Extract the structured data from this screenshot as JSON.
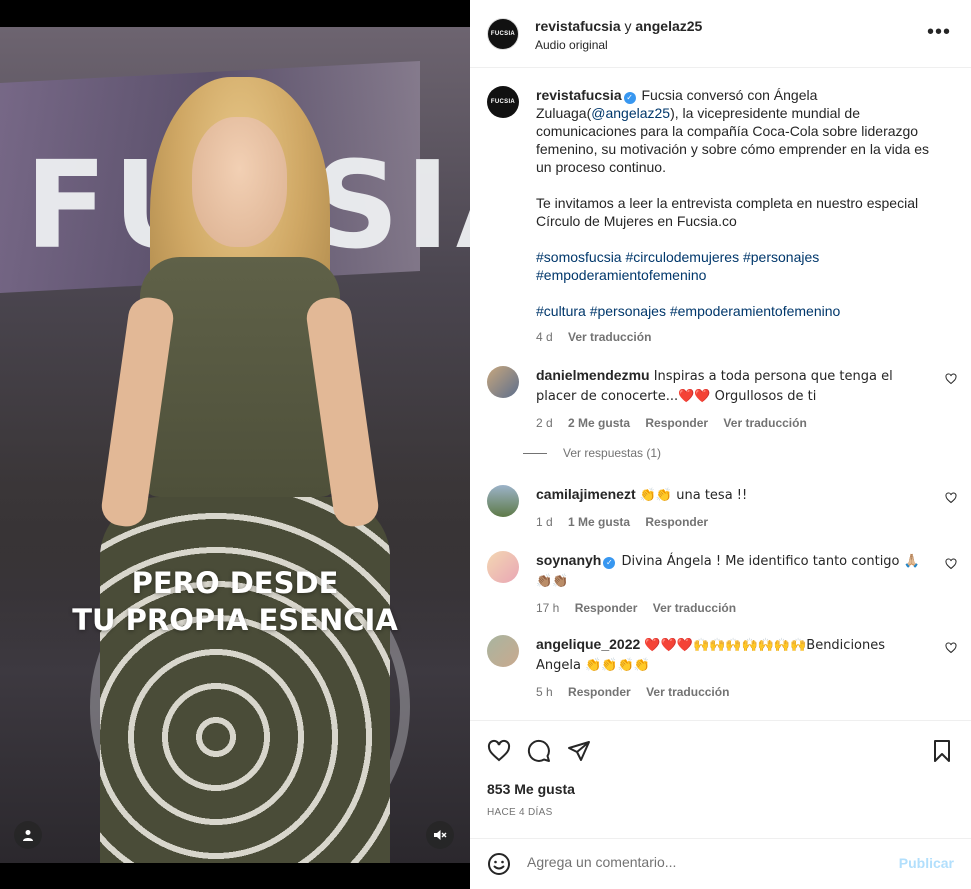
{
  "video": {
    "wall_brand": "FUCSIA",
    "overlay_line1": "PERO DESDE",
    "overlay_line2": "TU PROPIA ESENCIA"
  },
  "header": {
    "avatar_text": "FUCSIA",
    "user1": "revistafucsia",
    "joiner": " y ",
    "user2": "angelaz25",
    "subtitle": "Audio original",
    "more": "•••"
  },
  "caption": {
    "username": "revistafucsia",
    "verified_mark": "✓",
    "text1_a": " Fucsia conversó con Ángela Zuluaga(",
    "mention": "@angelaz25",
    "text1_b": "), la vicepresidente mundial de comunicaciones para la compañía Coca-Cola sobre liderazgo femenino, su motivación y sobre cómo emprender en la vida es un proceso continuo.",
    "text2": "Te invitamos a leer la entrevista completa en nuestro especial Círculo de Mujeres en Fucsia.co",
    "tags1": "#somosfucsia #circulodemujeres #personajes #empoderamientofemenino",
    "tags2": "#cultura #personajes #empoderamientofemenino",
    "time": "4 d",
    "translate": "Ver traducción"
  },
  "comments": [
    {
      "username": "danielmendezmu",
      "text": " Inspiras a toda persona que tenga el placer de conocerte...❤️❤️ Orgullosos de ti",
      "time": "2 d",
      "likes": "2 Me gusta",
      "reply": "Responder",
      "translate": "Ver traducción",
      "view_replies": "Ver respuestas (1)"
    },
    {
      "username": "camilajimenezt",
      "text": " 👏👏 una tesa !!",
      "time": "1 d",
      "likes": "1 Me gusta",
      "reply": "Responder"
    },
    {
      "username": "soynanyh",
      "verified_mark": "✓",
      "text": " Divina Ángela ! Me identifico tanto contigo 🙏🏼👏🏽👏🏽",
      "time": "17 h",
      "reply": "Responder",
      "translate": "Ver traducción"
    },
    {
      "username": "angelique_2022",
      "text": " ❤️❤️❤️🙌🙌🙌🙌🙌🙌🙌Bendiciones Angela 👏👏👏👏",
      "time": "5 h",
      "reply": "Responder",
      "translate": "Ver traducción"
    }
  ],
  "footer": {
    "likes": "853 Me gusta",
    "date": "HACE 4 DÍAS",
    "comment_placeholder": "Agrega un comentario...",
    "publish": "Publicar"
  },
  "colors": {
    "link": "#00376b",
    "verified": "#3897f0",
    "muted": "#737373",
    "publish_disabled": "#b2dffc"
  }
}
